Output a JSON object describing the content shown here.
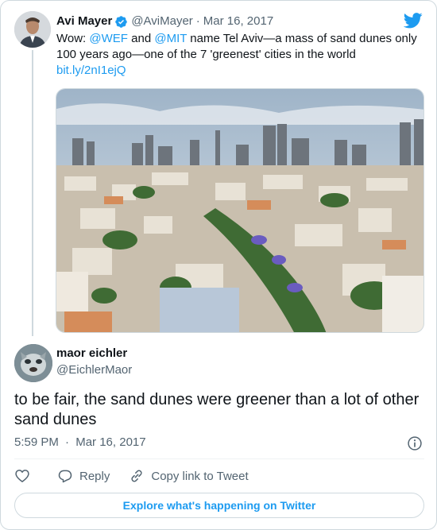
{
  "tweet": {
    "author_name": "Avi Mayer",
    "author_handle": "@AviMayer",
    "separator": "·",
    "date": "Mar 16, 2017",
    "text_prefix": "Wow: ",
    "mention_1": "@WEF",
    "text_and": " and ",
    "mention_2": "@MIT",
    "text_body": " name Tel Aviv—a mass of sand dunes only 100 years ago—one of the 7 'greenest' cities in the world",
    "link": "bit.ly/2nI1ejQ",
    "icons": [
      "verified-badge-icon",
      "twitter-bird-icon"
    ],
    "colors": {
      "accent": "#1d9bf0",
      "text": "#0f1419",
      "muted": "#536471",
      "border": "#cfd9de"
    }
  },
  "reply": {
    "author_name": "maor eichler",
    "author_handle": "@EichlerMaor",
    "text": "to be fair, the sand dunes were greener than a lot of other sand dunes",
    "time": "5:59 PM",
    "separator": "·",
    "date": "Mar 16, 2017"
  },
  "actions": {
    "reply_label": "Reply",
    "copy_label": "Copy link to Tweet",
    "icons": [
      "heart-icon",
      "reply-icon",
      "link-icon",
      "info-icon"
    ]
  },
  "explore": {
    "label": "Explore what's happening on Twitter"
  }
}
